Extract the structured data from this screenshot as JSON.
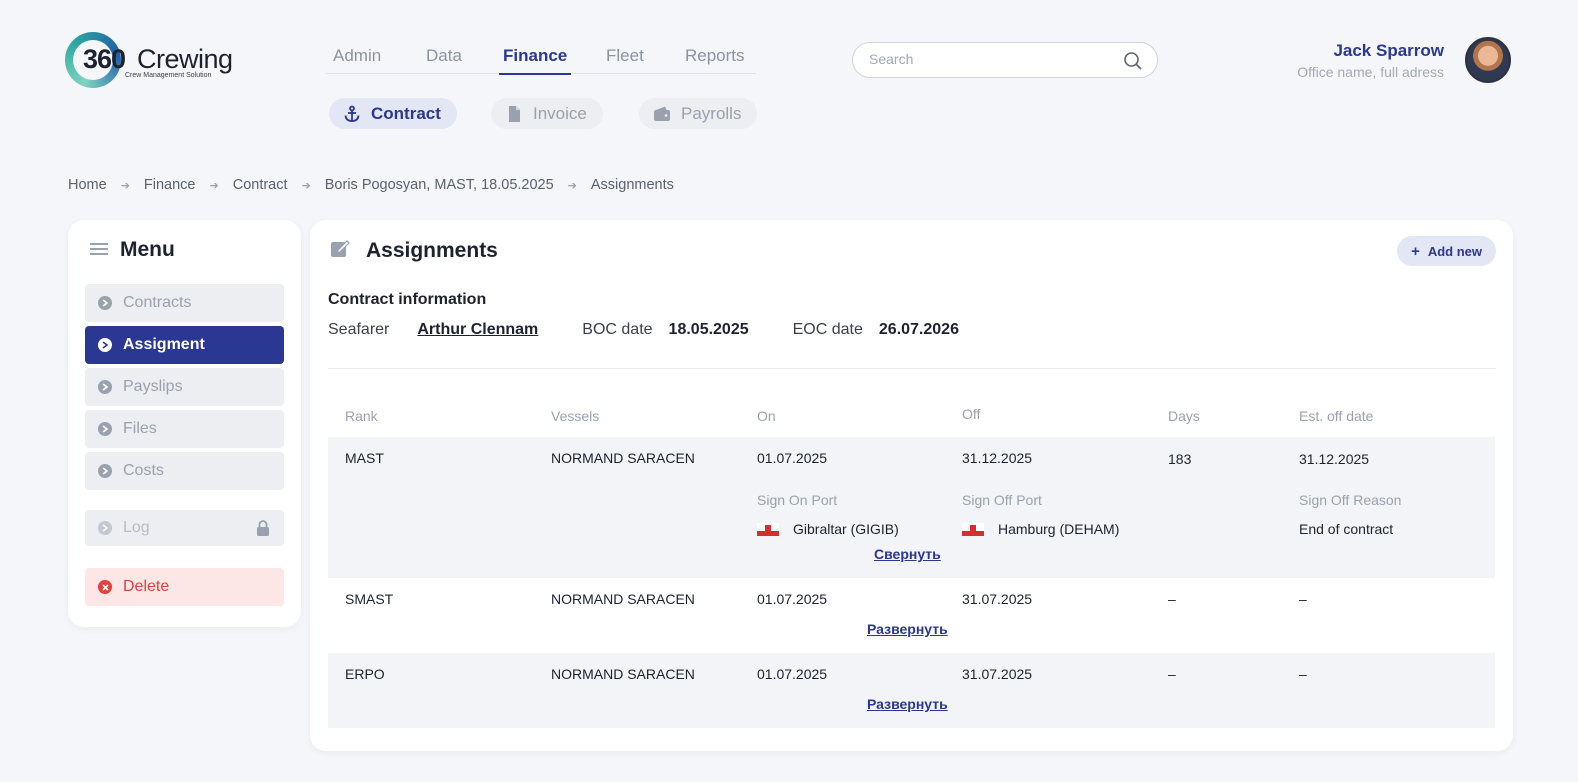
{
  "logo": {
    "number": "360",
    "word": "Crewing",
    "tagline": "Crew Management Solution"
  },
  "topnav": [
    {
      "label": "Admin"
    },
    {
      "label": "Data"
    },
    {
      "label": "Finance"
    },
    {
      "label": "Fleet"
    },
    {
      "label": "Reports"
    }
  ],
  "subnav": {
    "contract": "Contract",
    "invoice": "Invoice",
    "payrolls": "Payrolls"
  },
  "search": {
    "placeholder": "Search"
  },
  "user": {
    "name": "Jack Sparrow",
    "office": "Office name, full adress"
  },
  "breadcrumb": [
    "Home",
    "Finance",
    "Contract",
    "Boris Pogosyan, MAST, 18.05.2025",
    "Assignments"
  ],
  "menu": {
    "title": "Menu",
    "items": [
      "Contracts",
      "Assigment",
      "Payslips",
      "Files",
      "Costs"
    ],
    "log": "Log",
    "delete": "Delete"
  },
  "main": {
    "title": "Assignments",
    "add_new": "Add new",
    "contract_info_title": "Contract information",
    "seafarer_label": "Seafarer",
    "seafarer_value": "Arthur Clennam",
    "boc_label": "BOC date",
    "boc_value": "18.05.2025",
    "eoc_label": "EOC date",
    "eoc_value": "26.07.2026"
  },
  "table": {
    "headers": [
      "Rank",
      "Vessels",
      "On",
      "Off",
      "Days",
      "Est. off date"
    ],
    "rows": [
      {
        "rank": "MAST",
        "vessel": "NORMAND SARACEN",
        "on": "01.07.2025",
        "off": "31.12.2025",
        "days": "183",
        "est": "31.12.2025",
        "sign_on_port_label": "Sign On Port",
        "sign_on_port": "Gibraltar (GIGIB)",
        "sign_off_port_label": "Sign Off Port",
        "sign_off_port": "Hamburg (DEHAM)",
        "sign_off_reason_label": "Sign Off Reason",
        "sign_off_reason": "End of contract",
        "toggle": "Свернуть"
      },
      {
        "rank": "SMAST",
        "vessel": "NORMAND SARACEN",
        "on": "01.07.2025",
        "off": "31.07.2025",
        "days": "–",
        "est": "–",
        "toggle": "Развернуть"
      },
      {
        "rank": "ERPO",
        "vessel": "NORMAND SARACEN",
        "on": "01.07.2025",
        "off": "31.07.2025",
        "days": "–",
        "est": "–",
        "toggle": "Развернуть"
      }
    ]
  },
  "colors": {
    "accent": "#2a3793",
    "danger": "#e0413b",
    "muted": "#9aa1ae"
  }
}
